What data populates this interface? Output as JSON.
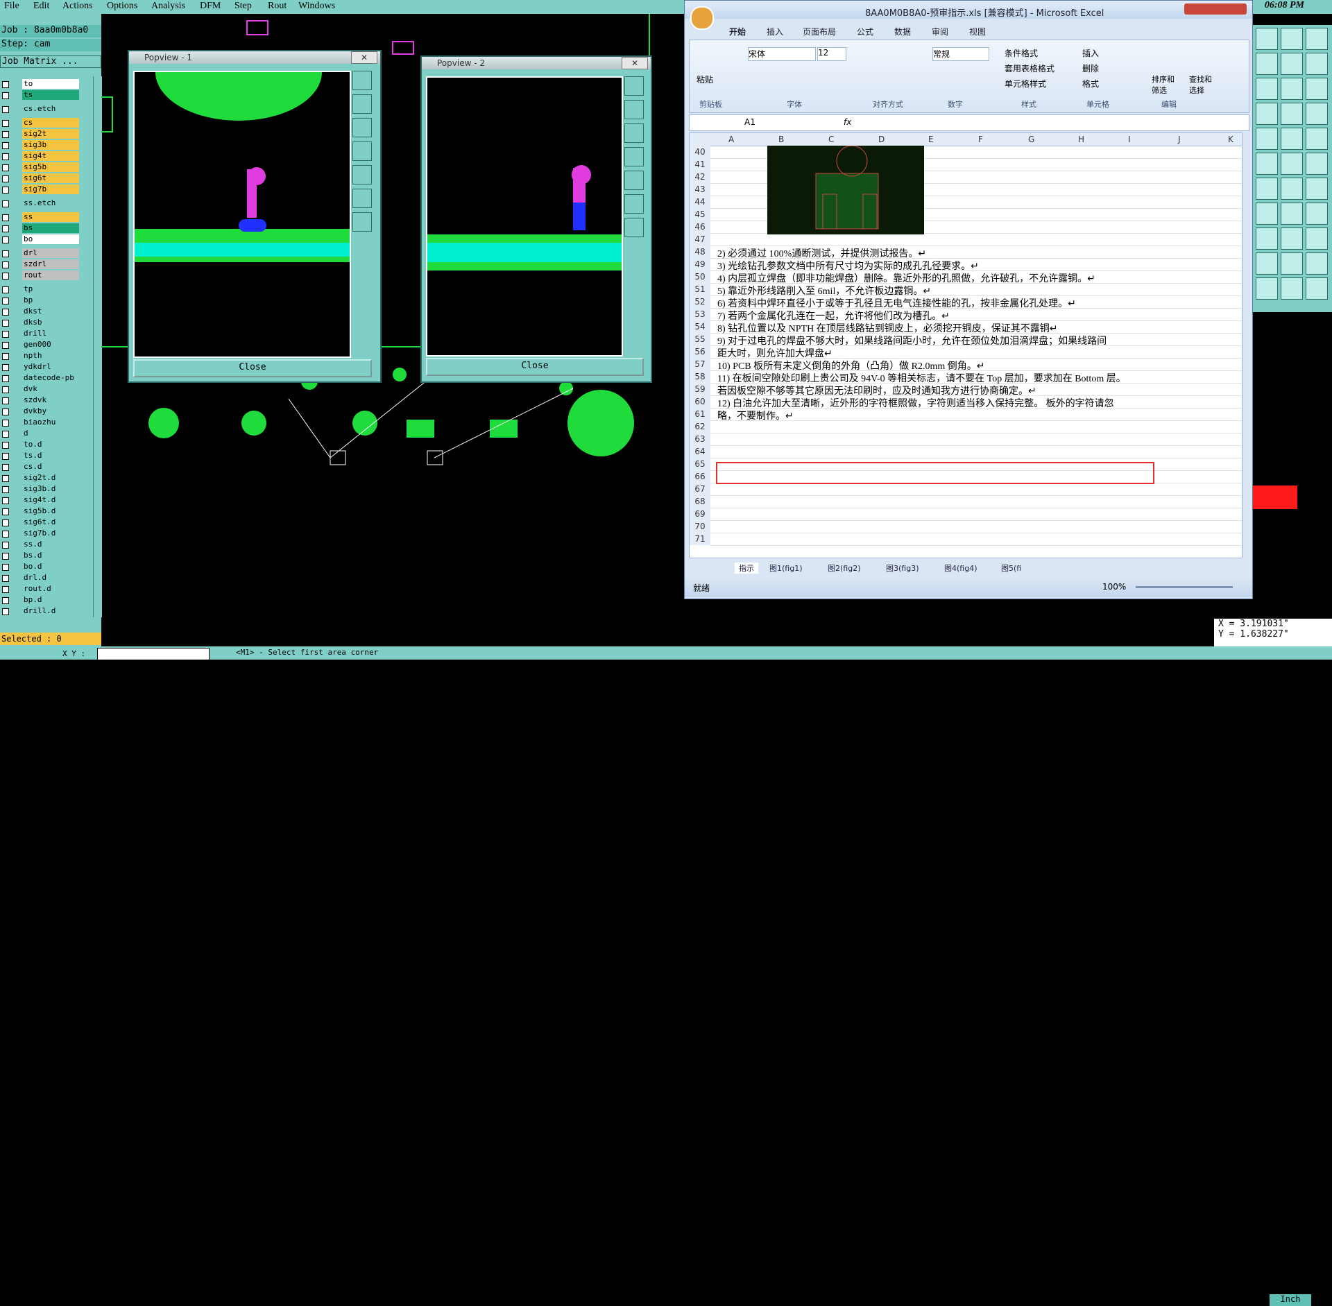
{
  "menubar": {
    "items": [
      "File",
      "Edit",
      "Actions",
      "Options",
      "Analysis",
      "DFM",
      "Step",
      "Rout",
      "Windows"
    ],
    "clock": "06:08 PM"
  },
  "left_panel": {
    "job": "Job : 8aa0m0b8a0",
    "step": "Step: cam",
    "job_matrix": "Job Matrix ...",
    "layers": [
      {
        "name": "to",
        "color": "#ffffff"
      },
      {
        "name": "ts",
        "color": "#1fa97a"
      },
      {
        "name": "cs.etch",
        "color": "#7fcfc7"
      },
      {
        "name": "cs",
        "color": "#f5c542"
      },
      {
        "name": "sig2t",
        "color": "#f5c542"
      },
      {
        "name": "sig3b",
        "color": "#f5c542"
      },
      {
        "name": "sig4t",
        "color": "#f5c542"
      },
      {
        "name": "sig5b",
        "color": "#f5c542"
      },
      {
        "name": "sig6t",
        "color": "#f5c542"
      },
      {
        "name": "sig7b",
        "color": "#f5c542"
      },
      {
        "name": "ss.etch",
        "color": "#7fcfc7"
      },
      {
        "name": "ss",
        "color": "#f5c542"
      },
      {
        "name": "bs",
        "color": "#1fa97a"
      },
      {
        "name": "bo",
        "color": "#ffffff"
      },
      {
        "name": "drl",
        "color": "#c0c0c0"
      },
      {
        "name": "szdrl",
        "color": "#c0c0c0"
      },
      {
        "name": "rout",
        "color": "#c0c0c0"
      },
      {
        "name": "tp",
        "color": "#7fcfc7"
      },
      {
        "name": "bp",
        "color": "#7fcfc7"
      },
      {
        "name": "dkst",
        "color": "#7fcfc7"
      },
      {
        "name": "dksb",
        "color": "#7fcfc7"
      },
      {
        "name": "drill",
        "color": "#7fcfc7"
      },
      {
        "name": "gen000",
        "color": "#7fcfc7"
      },
      {
        "name": "npth",
        "color": "#7fcfc7"
      },
      {
        "name": "ydkdrl",
        "color": "#7fcfc7"
      },
      {
        "name": "datecode-pb",
        "color": "#7fcfc7"
      },
      {
        "name": "dvk",
        "color": "#7fcfc7"
      },
      {
        "name": "szdvk",
        "color": "#7fcfc7"
      },
      {
        "name": "dvkby",
        "color": "#7fcfc7"
      },
      {
        "name": "biaozhu",
        "color": "#7fcfc7"
      },
      {
        "name": "d",
        "color": "#7fcfc7"
      },
      {
        "name": "to.d",
        "color": "#7fcfc7"
      },
      {
        "name": "ts.d",
        "color": "#7fcfc7"
      },
      {
        "name": "cs.d",
        "color": "#7fcfc7"
      },
      {
        "name": "sig2t.d",
        "color": "#7fcfc7"
      },
      {
        "name": "sig3b.d",
        "color": "#7fcfc7"
      },
      {
        "name": "sig4t.d",
        "color": "#7fcfc7"
      },
      {
        "name": "sig5b.d",
        "color": "#7fcfc7"
      },
      {
        "name": "sig6t.d",
        "color": "#7fcfc7"
      },
      {
        "name": "sig7b.d",
        "color": "#7fcfc7"
      },
      {
        "name": "ss.d",
        "color": "#7fcfc7"
      },
      {
        "name": "bs.d",
        "color": "#7fcfc7"
      },
      {
        "name": "bo.d",
        "color": "#7fcfc7"
      },
      {
        "name": "drl.d",
        "color": "#7fcfc7"
      },
      {
        "name": "rout.d",
        "color": "#7fcfc7"
      },
      {
        "name": "bp.d",
        "color": "#7fcfc7"
      },
      {
        "name": "drill.d",
        "color": "#7fcfc7"
      }
    ],
    "selected": "Selected : 0"
  },
  "popview1": {
    "title": "Popview - 1",
    "close": "Close"
  },
  "popview2": {
    "title": "Popview - 2",
    "close": "Close"
  },
  "excel": {
    "title": "8AA0M0B8A0-预审指示.xls [兼容模式] - Microsoft Excel",
    "tabs": [
      "开始",
      "插入",
      "页面布局",
      "公式",
      "数据",
      "审阅",
      "视图"
    ],
    "ribbon": {
      "paste": "粘贴",
      "font_name": "宋体",
      "font_size": "12",
      "number_format": "常规",
      "cond_format": "条件格式",
      "table_format": "套用表格格式",
      "cell_style": "单元格样式",
      "insert": "插入",
      "delete": "删除",
      "format": "格式",
      "sort": "排序和\n筛选",
      "find": "查找和\n选择",
      "groups": [
        "剪贴板",
        "字体",
        "对齐方式",
        "数字",
        "样式",
        "单元格",
        "编辑"
      ]
    },
    "namebox": "A1",
    "fx": "fx",
    "columns": [
      "A",
      "B",
      "C",
      "D",
      "E",
      "F",
      "G",
      "H",
      "I",
      "J",
      "K"
    ],
    "rows": [
      "40",
      "41",
      "42",
      "43",
      "44",
      "45",
      "46",
      "47",
      "48",
      "49",
      "50",
      "51",
      "52",
      "53",
      "54",
      "55",
      "56",
      "57",
      "58",
      "59",
      "60",
      "61",
      "62",
      "63",
      "64",
      "65",
      "66",
      "67",
      "68",
      "69",
      "70",
      "71"
    ],
    "lines": [
      {
        "row": 8,
        "text": "2)   必须通过 100%通断测试，并提供测试报告。↵"
      },
      {
        "row": 9,
        "text": "3)   光绘钻孔参数文档中所有尺寸均为实际的成孔孔径要求。↵"
      },
      {
        "row": 10,
        "text": "4)   内层孤立焊盘（即非功能焊盘）删除。靠近外形的孔照做，允许破孔，不允许露铜。↵"
      },
      {
        "row": 11,
        "text": "5)   靠近外形线路削入至 6mil，不允许板边露铜。↵"
      },
      {
        "row": 12,
        "text": "6)   若资料中焊环直径小于或等于孔径且无电气连接性能的孔，按非金属化孔处理。↵"
      },
      {
        "row": 13,
        "text": "7)   若两个金属化孔连在一起，允许将他们改为槽孔。↵"
      },
      {
        "row": 14,
        "text": "8)   钻孔位置以及 NPTH 在顶层线路钻到铜皮上，必须挖开铜皮，保证其不露铜↵"
      },
      {
        "row": 15,
        "text": "9)   对于过电孔的焊盘不够大时，如果线路间距小时，允许在颈位处加泪滴焊盘；如果线路间"
      },
      {
        "row": 16,
        "text": "      距大时，则允许加大焊盘↵"
      },
      {
        "row": 17,
        "text": "10)  PCB 板所有未定义倒角的外角（凸角）做 R2.0mm 倒角。↵"
      },
      {
        "row": 18,
        "text": "11)  在板间空隙处印刷上贵公司及 94V-0 等相关标志，请不要在 Top 层加，要求加在 Bottom 层。"
      },
      {
        "row": 19,
        "text": "      若因板空隙不够等其它原因无法印刷时，应及时通知我方进行协商确定。↵"
      },
      {
        "row": 20,
        "text": "12)  白油允许加大至清晰，近外形的字符框照做，字符则适当移入保持完整。 板外的字符请忽"
      },
      {
        "row": 21,
        "text": "      略，不要制作。↵"
      }
    ],
    "sheet_tabs": [
      "指示",
      "图1(fig1)",
      "图2(fig2)",
      "图3(fig3)",
      "图4(fig4)",
      "图5(fi"
    ],
    "status": "就绪",
    "zoom": "100%"
  },
  "coords": {
    "x": "X = 3.191031\"",
    "y": "Y = 1.638227\""
  },
  "bottombar": {
    "xy_label": "X Y :",
    "prompt": "<M1> - Select first area corner",
    "unit": "Inch"
  }
}
